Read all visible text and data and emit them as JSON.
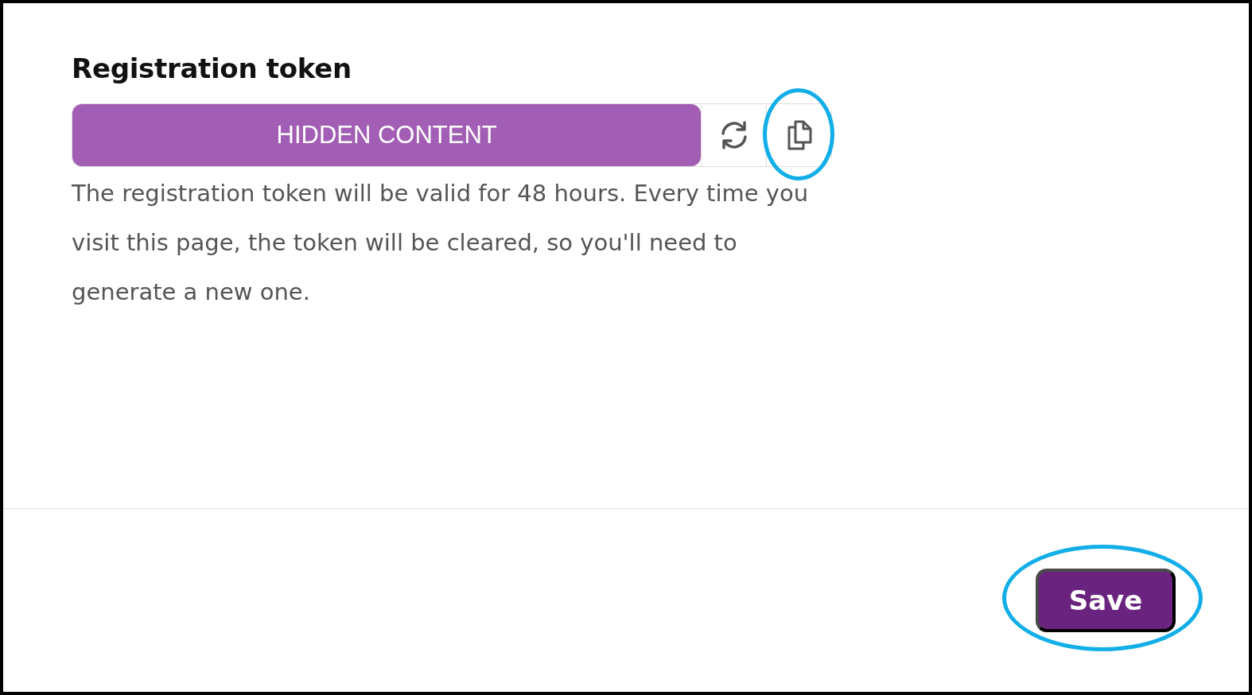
{
  "section": {
    "title": "Registration token",
    "token": {
      "redacted_label": "HIDDEN CONTENT"
    },
    "actions": [
      {
        "kind": "regenerate",
        "highlighted": false
      },
      {
        "kind": "copy",
        "highlighted": true
      }
    ],
    "help_text": "The registration token will be valid for 48 hours. Every time you visit this page, the token will be cleared, so you'll need to generate a new one."
  },
  "footer": {
    "save_button": {
      "label": "Save",
      "highlighted": true
    }
  }
}
